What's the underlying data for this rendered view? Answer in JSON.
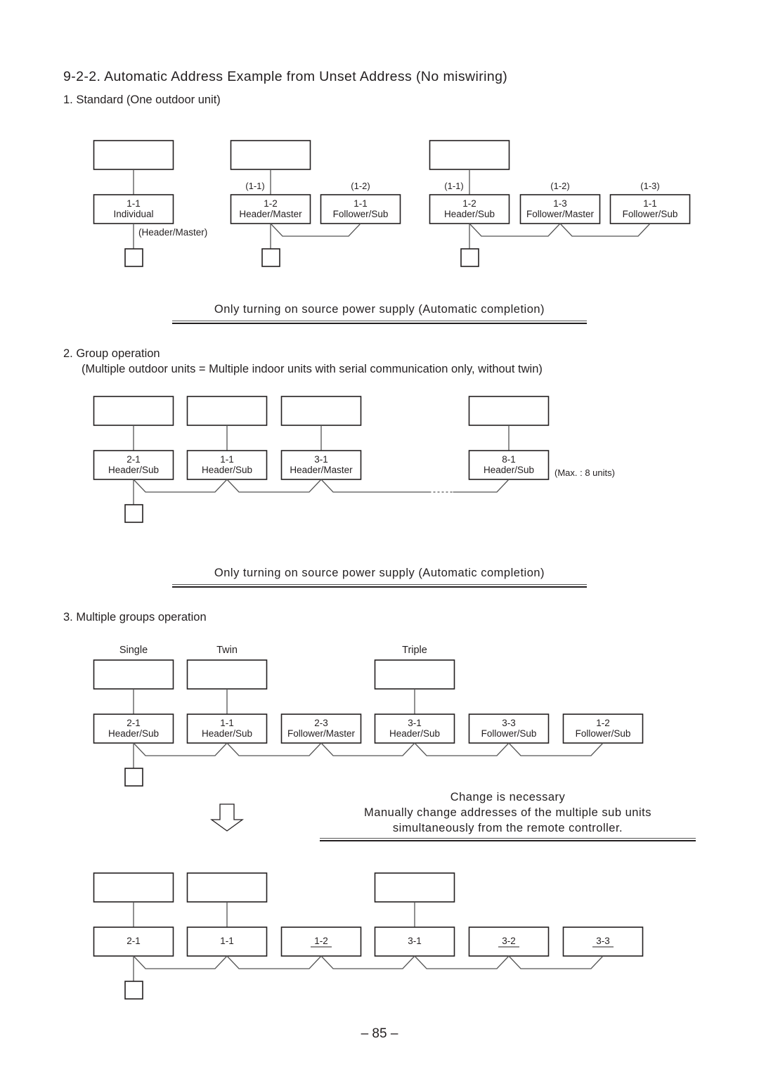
{
  "heading": {
    "title": "9-2-2. Automatic Address Example from Unset Address (No miswiring)"
  },
  "section1": {
    "title": "1.  Standard (One outdoor unit)",
    "groups": [
      {
        "units": [
          {
            "address": "1-1",
            "role": "Individual",
            "note": "(Header/Master)"
          }
        ]
      },
      {
        "units": [
          {
            "address": "1-2",
            "role": "Header/Master",
            "original": "(1-1)"
          },
          {
            "address": "1-1",
            "role": "Follower/Sub",
            "original": "(1-2)"
          }
        ]
      },
      {
        "units": [
          {
            "address": "1-2",
            "role": "Header/Sub",
            "original": "(1-1)"
          },
          {
            "address": "1-3",
            "role": "Follower/Master",
            "original": "(1-2)"
          },
          {
            "address": "1-1",
            "role": "Follower/Sub",
            "original": "(1-3)"
          }
        ]
      }
    ],
    "result": "Only turning on source power supply (Automatic completion)"
  },
  "section2": {
    "title": "2.  Group operation",
    "subtitle": "(Multiple outdoor units = Multiple indoor units with serial communication only, without twin)",
    "units": [
      {
        "address": "2-1",
        "role": "Header/Sub"
      },
      {
        "address": "1-1",
        "role": "Header/Sub"
      },
      {
        "address": "3-1",
        "role": "Header/Master"
      },
      {
        "address": "8-1",
        "role": "Header/Sub"
      }
    ],
    "max_note": "(Max. : 8 units)",
    "result": "Only turning on source power supply (Automatic completion)"
  },
  "section3": {
    "title": "3.  Multiple groups operation",
    "group_labels": [
      "Single",
      "Twin",
      "Triple"
    ],
    "before_units": [
      {
        "address": "2-1",
        "role": "Header/Sub"
      },
      {
        "address": "1-1",
        "role": "Header/Sub"
      },
      {
        "address": "2-3",
        "role": "Follower/Master"
      },
      {
        "address": "3-1",
        "role": "Header/Sub"
      },
      {
        "address": "3-3",
        "role": "Follower/Sub"
      },
      {
        "address": "1-2",
        "role": "Follower/Sub"
      }
    ],
    "change_note": {
      "line1": "Change is necessary",
      "line2": "Manually change addresses of the multiple sub units",
      "line3": "simultaneously from the remote controller."
    },
    "after_units": [
      {
        "address": "2-1",
        "changed": false
      },
      {
        "address": "1-1",
        "changed": false
      },
      {
        "address": "1-2",
        "changed": true
      },
      {
        "address": "3-1",
        "changed": false
      },
      {
        "address": "3-2",
        "changed": true
      },
      {
        "address": "3-3",
        "changed": true
      }
    ]
  },
  "page_number": "– 85 –"
}
